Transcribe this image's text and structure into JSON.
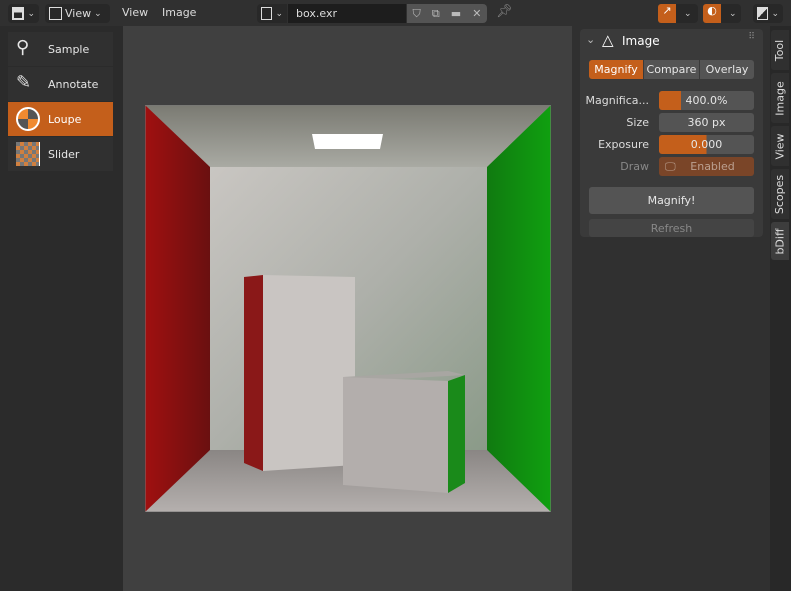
{
  "header": {
    "editor_type_icon": "image-editor-icon",
    "view_menu_button": "View",
    "menus": [
      "View",
      "Image"
    ],
    "image_browse_icon": "image-icon",
    "image_name": "box.exr",
    "icons": [
      "fake-user-shield-icon",
      "duplicate-icon",
      "open-folder-icon",
      "close-icon",
      "pin-icon",
      "gizmo-icon",
      "overlay-icon",
      "display-channels-icon"
    ]
  },
  "toolbar": {
    "tools": [
      {
        "label": "Sample",
        "icon": "eyedropper-icon"
      },
      {
        "label": "Annotate",
        "icon": "annotate-pencil-icon"
      },
      {
        "label": "Loupe",
        "icon": "loupe-icon",
        "active": true
      },
      {
        "label": "Slider",
        "icon": "slider-icon"
      }
    ]
  },
  "panel": {
    "title": "Image",
    "tabs": [
      "Magnify",
      "Compare",
      "Overlay"
    ],
    "active_tab": "Magnify",
    "fields": {
      "magnification_label": "Magnifica...",
      "magnification_value": "400.0%",
      "magnification_fill": 0.15,
      "size_label": "Size",
      "size_value": "360 px",
      "exposure_label": "Exposure",
      "exposure_value": "0.000",
      "exposure_fill": 0.5,
      "draw_label": "Draw",
      "draw_value": "Enabled"
    },
    "magnify_button": "Magnify!",
    "refresh_button": "Refresh"
  },
  "side_tabs": [
    "Tool",
    "Image",
    "View",
    "Scopes",
    "bDiff"
  ],
  "colors": {
    "accent": "#c45f1b",
    "bg": "#303030"
  }
}
